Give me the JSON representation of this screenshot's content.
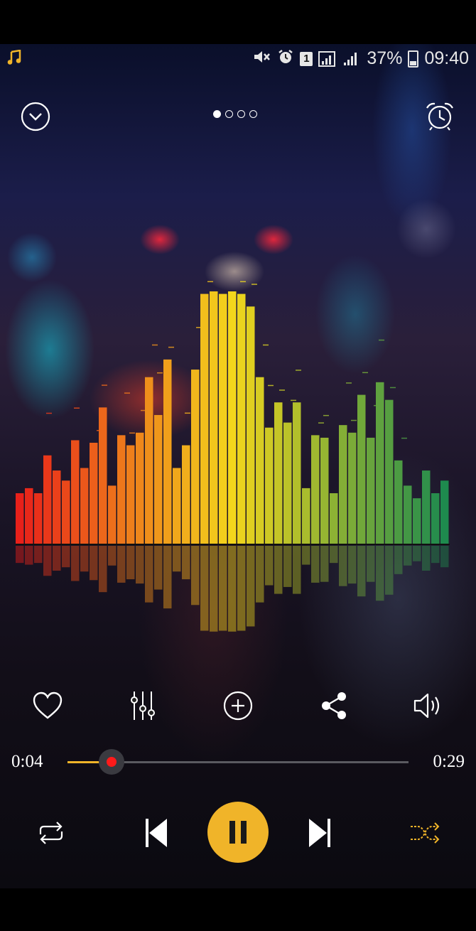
{
  "status": {
    "app_icon": "music-note-icon",
    "battery_percent": "37%",
    "time": "09:40",
    "sim_badge": "1",
    "icons": [
      "mute-icon",
      "alarm-icon",
      "sim-icon",
      "signal-icon",
      "battery-icon"
    ]
  },
  "header": {
    "collapse_icon": "chevron-down-circle-icon",
    "page_indicator": {
      "count": 4,
      "active": 0
    },
    "alarm_icon": "alarm-clock-icon"
  },
  "visualizer": {
    "bars": [
      0.2,
      0.22,
      0.2,
      0.35,
      0.29,
      0.25,
      0.41,
      0.3,
      0.4,
      0.54,
      0.23,
      0.43,
      0.39,
      0.44,
      0.66,
      0.51,
      0.73,
      0.3,
      0.39,
      0.69,
      0.99,
      1.0,
      0.99,
      1.0,
      0.99,
      0.94,
      0.66,
      0.46,
      0.56,
      0.48,
      0.56,
      0.22,
      0.43,
      0.42,
      0.2,
      0.47,
      0.44,
      0.59,
      0.42,
      0.64,
      0.57,
      0.33,
      0.23,
      0.18,
      0.29,
      0.2,
      0.25
    ],
    "colors": {
      "start": "#e8201a",
      "mid": "#f3d61c",
      "end": "#1e8a4e"
    }
  },
  "actions": [
    {
      "name": "favorite",
      "icon": "heart-icon"
    },
    {
      "name": "equalizer",
      "icon": "equalizer-icon"
    },
    {
      "name": "add-to-playlist",
      "icon": "plus-circle-icon"
    },
    {
      "name": "share",
      "icon": "share-icon"
    },
    {
      "name": "volume",
      "icon": "volume-icon"
    }
  ],
  "playback": {
    "elapsed": "0:04",
    "total": "0:29",
    "progress": 0.13,
    "accent": "#f0b429",
    "thumb_color": "#ff1a1a"
  },
  "controls": {
    "repeat_icon": "repeat-icon",
    "previous_icon": "skip-previous-icon",
    "play_pause_icon": "pause-icon",
    "next_icon": "skip-next-icon",
    "shuffle_icon": "shuffle-icon"
  }
}
